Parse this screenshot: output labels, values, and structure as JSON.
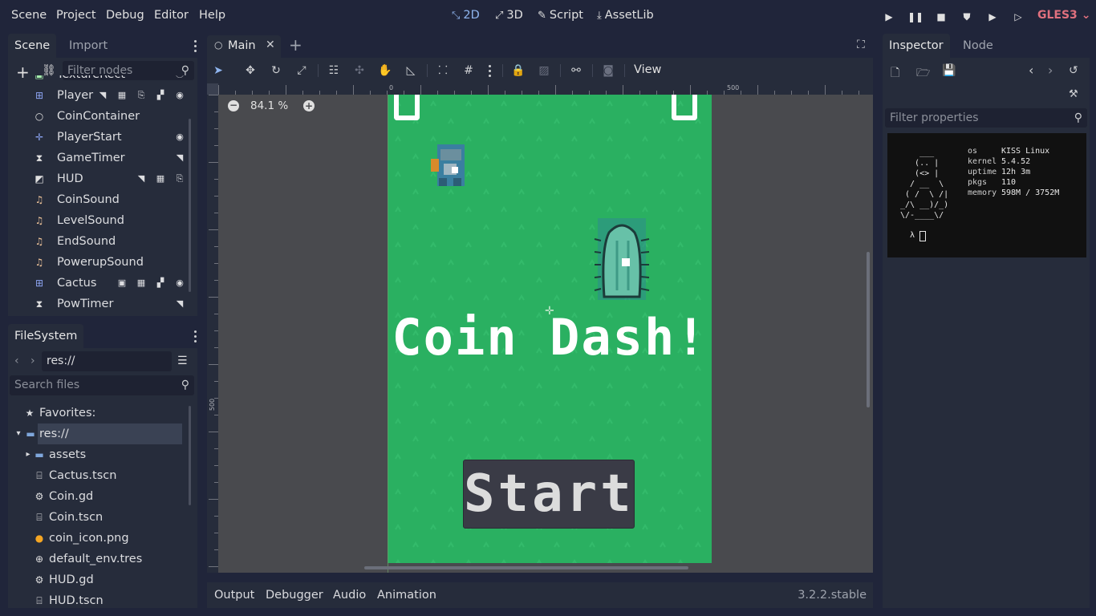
{
  "menu": [
    "Scene",
    "Project",
    "Debug",
    "Editor",
    "Help"
  ],
  "modes": [
    {
      "icon": "2d-icon",
      "glyph": "⤡",
      "label": "2D",
      "active": true
    },
    {
      "icon": "3d-icon",
      "glyph": "⤢",
      "label": "3D",
      "active": false
    },
    {
      "icon": "script-icon",
      "glyph": "✎",
      "label": "Script",
      "active": false
    },
    {
      "icon": "assetlib-icon",
      "glyph": "⤓",
      "label": "AssetLib",
      "active": false
    }
  ],
  "renderer": "GLES3",
  "scene_dock": {
    "tabs": [
      "Scene",
      "Import"
    ],
    "filter_placeholder": "Filter nodes",
    "nodes": [
      {
        "label": "TextureRect",
        "icon": "texturerect-icon",
        "glyph": "▣",
        "color": "#a5efac",
        "badges": [
          "⦿"
        ]
      },
      {
        "label": "Player",
        "icon": "area2d-icon",
        "glyph": "⊞",
        "color": "#8da5f3",
        "badges": [
          "◥",
          "▦",
          "⎘",
          "▞",
          "◉"
        ]
      },
      {
        "label": "CoinContainer",
        "icon": "node-icon",
        "glyph": "○",
        "color": "#e0e0e0",
        "badges": []
      },
      {
        "label": "PlayerStart",
        "icon": "position2d-icon",
        "glyph": "✛",
        "color": "#8da5f3",
        "badges": [
          "◉"
        ]
      },
      {
        "label": "GameTimer",
        "icon": "timer-icon",
        "glyph": "⧗",
        "color": "#e0e0e0",
        "badges": [
          "◥"
        ]
      },
      {
        "label": "HUD",
        "icon": "canvaslayer-icon",
        "glyph": "◩",
        "color": "#e0e0e0",
        "badges": [
          "◥",
          "▦",
          "⎘"
        ]
      },
      {
        "label": "CoinSound",
        "icon": "audio-icon",
        "glyph": "♫",
        "color": "#f0c59a",
        "badges": []
      },
      {
        "label": "LevelSound",
        "icon": "audio-icon",
        "glyph": "♫",
        "color": "#f0c59a",
        "badges": []
      },
      {
        "label": "EndSound",
        "icon": "audio-icon",
        "glyph": "♫",
        "color": "#f0c59a",
        "badges": []
      },
      {
        "label": "PowerupSound",
        "icon": "audio-icon",
        "glyph": "♫",
        "color": "#f0c59a",
        "badges": []
      },
      {
        "label": "Cactus",
        "icon": "area2d-icon",
        "glyph": "⊞",
        "color": "#8da5f3",
        "badges": [
          "▣",
          "▦",
          "▞",
          "◉"
        ]
      },
      {
        "label": "PowTimer",
        "icon": "timer-icon",
        "glyph": "⧗",
        "color": "#e0e0e0",
        "badges": [
          "◥"
        ]
      }
    ]
  },
  "filesystem": {
    "tab": "FileSystem",
    "path": "res://",
    "search_placeholder": "Search files",
    "favorites": "Favorites:",
    "root": "res://",
    "items": [
      {
        "label": "assets",
        "icon": "folder-icon",
        "glyph": "▬",
        "color": "#7fa7dc",
        "expandable": true
      },
      {
        "label": "Cactus.tscn",
        "icon": "scene-file-icon",
        "glyph": "⌸",
        "color": "#e0e0e0"
      },
      {
        "label": "Coin.gd",
        "icon": "gdscript-icon",
        "glyph": "⚙",
        "color": "#e0e0e0"
      },
      {
        "label": "Coin.tscn",
        "icon": "scene-file-icon",
        "glyph": "⌸",
        "color": "#e0e0e0"
      },
      {
        "label": "coin_icon.png",
        "icon": "image-icon",
        "glyph": "●",
        "color": "#f5a623"
      },
      {
        "label": "default_env.tres",
        "icon": "environment-icon",
        "glyph": "⊕",
        "color": "#e0e0e0"
      },
      {
        "label": "HUD.gd",
        "icon": "gdscript-icon",
        "glyph": "⚙",
        "color": "#e0e0e0"
      },
      {
        "label": "HUD.tscn",
        "icon": "scene-file-icon",
        "glyph": "⌸",
        "color": "#e0e0e0"
      }
    ]
  },
  "editor": {
    "tab": "Main",
    "view_menu": "View",
    "zoom": "84.1 %",
    "ruler_labels": {
      "h0": "0",
      "h500": "500",
      "v500": "500"
    },
    "game_title": "Coin Dash!",
    "start_label": "Start"
  },
  "bottom_panel": {
    "tabs": [
      "Output",
      "Debugger",
      "Audio",
      "Animation"
    ],
    "version": "3.2.2.stable"
  },
  "inspector": {
    "tabs": [
      "Inspector",
      "Node"
    ],
    "filter_placeholder": "Filter properties",
    "neofetch": {
      "logo": "    ___\n   (.. |\n   (<> |\n  / __  \\\n ( /  \\ /|\n_/\\ __)/_)\n\\/-____\\/",
      "prompt": "λ",
      "fields": [
        {
          "key": "os",
          "value": "KISS Linux"
        },
        {
          "key": "kernel",
          "value": "5.4.52"
        },
        {
          "key": "uptime",
          "value": "12h 3m"
        },
        {
          "key": "pkgs",
          "value": "110"
        },
        {
          "key": "memory",
          "value": "598M / 3752M"
        }
      ]
    }
  }
}
